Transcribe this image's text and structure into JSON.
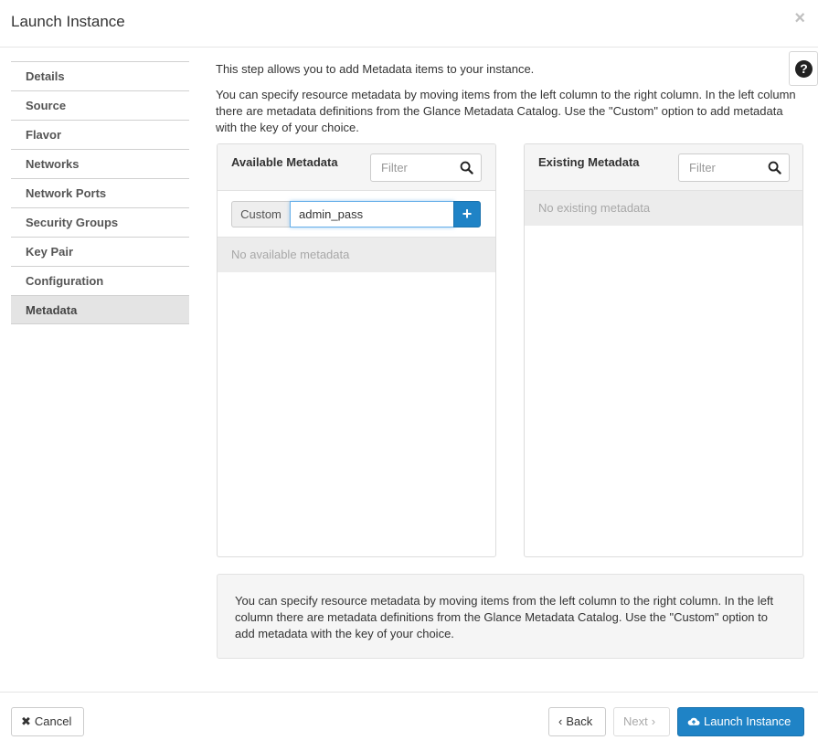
{
  "modal": {
    "title": "Launch Instance",
    "close_icon": "×"
  },
  "sidebar": {
    "items": [
      {
        "label": "Details"
      },
      {
        "label": "Source"
      },
      {
        "label": "Flavor"
      },
      {
        "label": "Networks"
      },
      {
        "label": "Network Ports"
      },
      {
        "label": "Security Groups"
      },
      {
        "label": "Key Pair"
      },
      {
        "label": "Configuration"
      },
      {
        "label": "Metadata",
        "active": true
      }
    ]
  },
  "help_button": {
    "icon": "question-circle-icon",
    "glyph": "?"
  },
  "intro": {
    "line1": "This step allows you to add Metadata items to your instance.",
    "line2": "You can specify resource metadata by moving items from the left column to the right column. In the left column there are metadata definitions from the Glance Metadata Catalog. Use the \"Custom\" option to add metadata with the key of your choice."
  },
  "available": {
    "title": "Available Metadata",
    "filter_placeholder": "Filter",
    "custom_label": "Custom",
    "custom_value": "admin_pass",
    "add_glyph": "+",
    "empty_text": "No available metadata"
  },
  "existing": {
    "title": "Existing Metadata",
    "filter_placeholder": "Filter",
    "empty_text": "No existing metadata"
  },
  "help_text": "You can specify resource metadata by moving items from the left column to the right column. In the left column there are metadata definitions from the Glance Metadata Catalog. Use the \"Custom\" option to add metadata with the key of your choice.",
  "footer": {
    "cancel_label": "Cancel",
    "back_label": "Back",
    "next_label": "Next",
    "launch_label": "Launch Instance"
  },
  "colors": {
    "primary": "#1f83c6",
    "active_nav": "#e4e4e4",
    "empty_row": "#ececec"
  }
}
